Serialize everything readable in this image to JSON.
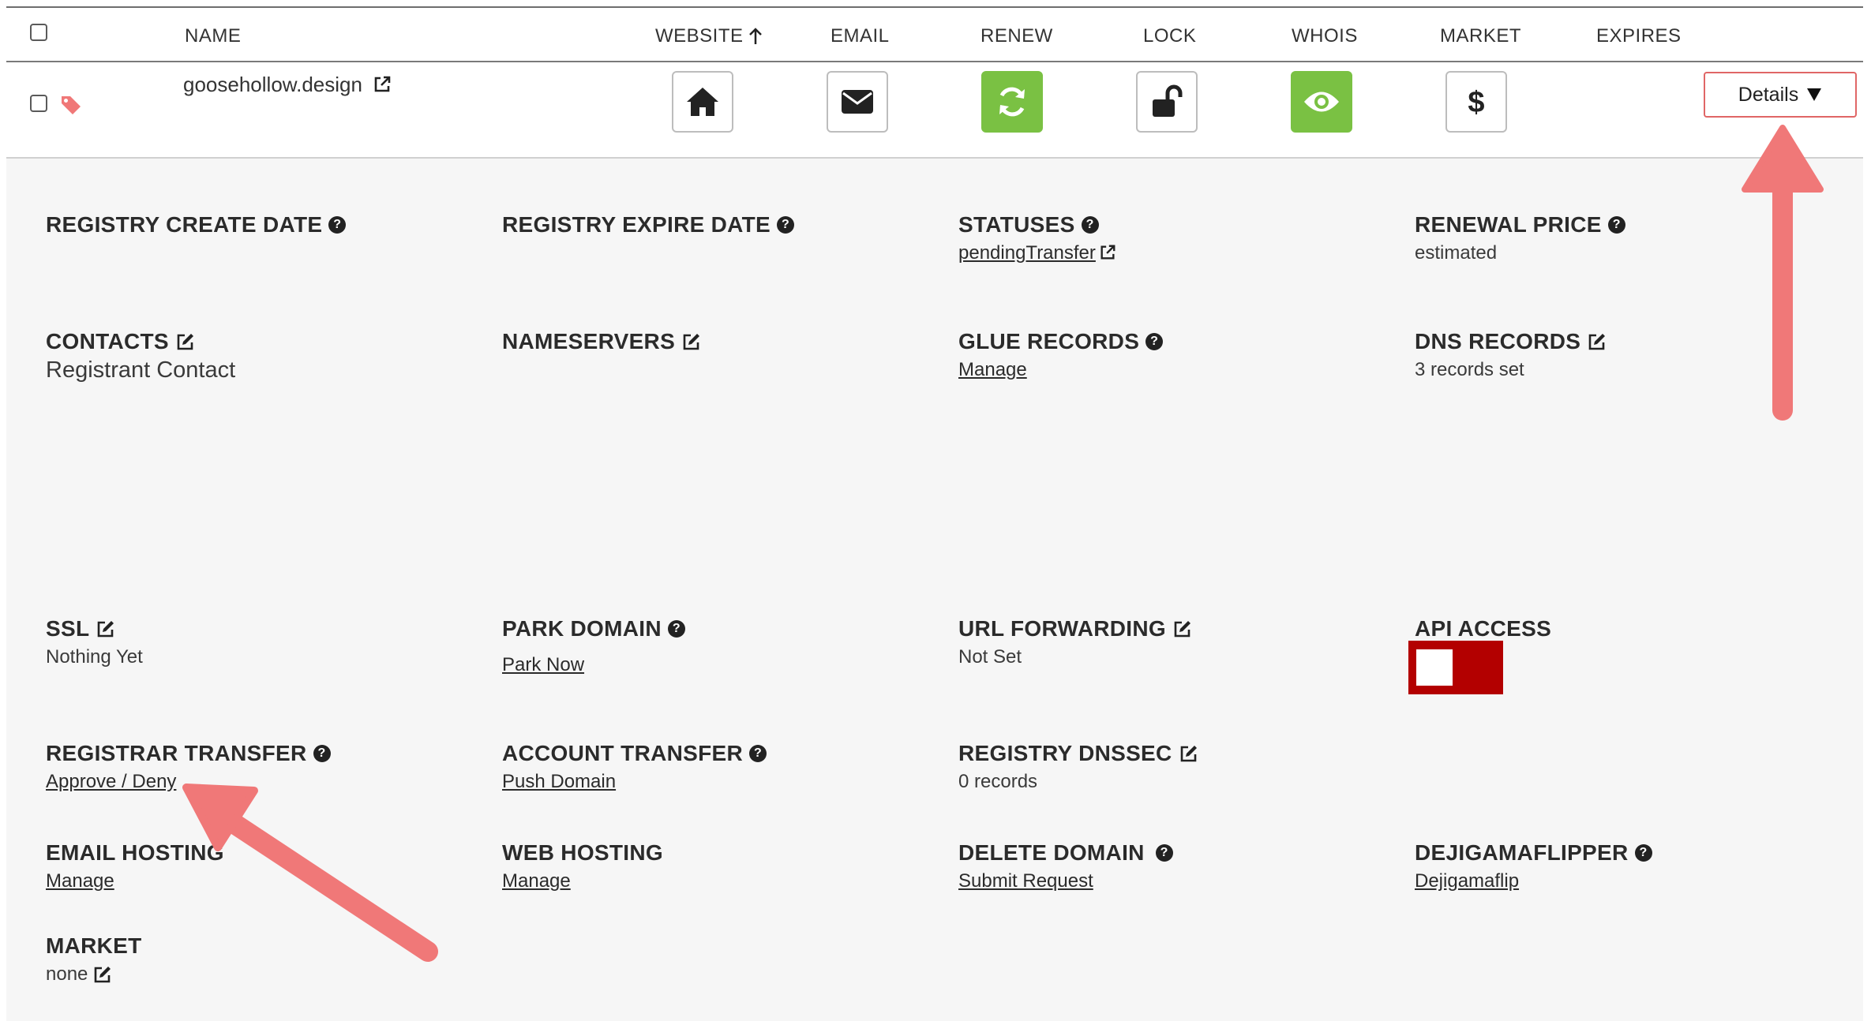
{
  "header": {
    "columns": [
      "NAME",
      "WEBSITE",
      "EMAIL",
      "RENEW",
      "LOCK",
      "WHOIS",
      "MARKET",
      "EXPIRES"
    ],
    "sort_indicator": "arrow-up-icon"
  },
  "row": {
    "domain": "goosehollow.design",
    "details_label": "Details",
    "colors": {
      "green": "#7ac143",
      "details_border": "#e06666"
    }
  },
  "panel": {
    "registry_create_date": {
      "title": "REGISTRY CREATE DATE"
    },
    "registry_expire_date": {
      "title": "REGISTRY EXPIRE DATE"
    },
    "statuses": {
      "title": "STATUSES",
      "value": "pendingTransfer"
    },
    "renewal_price": {
      "title": "RENEWAL PRICE",
      "value": "estimated"
    },
    "contacts": {
      "title": "CONTACTS",
      "value": "Registrant Contact"
    },
    "nameservers": {
      "title": "NAMESERVERS"
    },
    "glue_records": {
      "title": "GLUE RECORDS",
      "value": "Manage"
    },
    "dns_records": {
      "title": "DNS RECORDS",
      "value": "3 records set"
    },
    "ssl": {
      "title": "SSL",
      "value": "Nothing Yet"
    },
    "park_domain": {
      "title": "PARK DOMAIN",
      "value": "Park Now"
    },
    "url_forwarding": {
      "title": "URL FORWARDING",
      "value": "Not Set"
    },
    "api_access": {
      "title": "API ACCESS",
      "enabled": false,
      "color": "#b30000"
    },
    "registrar_transfer": {
      "title": "REGISTRAR TRANSFER",
      "value": "Approve / Deny"
    },
    "account_transfer": {
      "title": "ACCOUNT TRANSFER",
      "value": "Push Domain"
    },
    "registry_dnssec": {
      "title": "REGISTRY DNSSEC",
      "value": "0 records"
    },
    "email_hosting": {
      "title": "EMAIL HOSTING",
      "value": "Manage"
    },
    "web_hosting": {
      "title": "WEB HOSTING",
      "value": "Manage"
    },
    "delete_domain": {
      "title": "DELETE DOMAIN",
      "value": "Submit Request"
    },
    "dejigamaflipper": {
      "title": "DEJIGAMAFLIPPER",
      "value": "Dejigamaflip"
    },
    "market": {
      "title": "MARKET",
      "value": "none"
    }
  },
  "help_glyph": "?",
  "annotation_color": "#f07878"
}
